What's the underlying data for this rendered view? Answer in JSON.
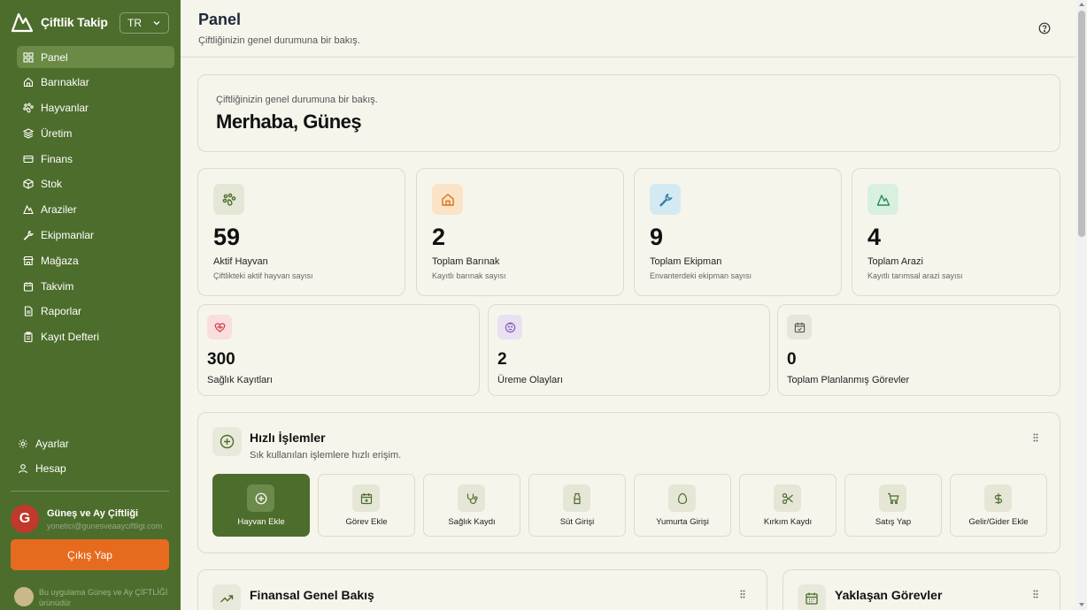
{
  "app": {
    "name": "Çiftlik Takip",
    "language": "TR"
  },
  "sidebar": {
    "items": [
      {
        "label": "Panel",
        "icon": "grid-icon",
        "active": true
      },
      {
        "label": "Barınaklar",
        "icon": "home-icon"
      },
      {
        "label": "Hayvanlar",
        "icon": "paw-icon"
      },
      {
        "label": "Üretim",
        "icon": "layers-icon"
      },
      {
        "label": "Finans",
        "icon": "card-icon"
      },
      {
        "label": "Stok",
        "icon": "box-icon"
      },
      {
        "label": "Araziler",
        "icon": "mountain-icon"
      },
      {
        "label": "Ekipmanlar",
        "icon": "wrench-icon"
      },
      {
        "label": "Mağaza",
        "icon": "store-icon"
      },
      {
        "label": "Takvim",
        "icon": "calendar-icon"
      },
      {
        "label": "Raporlar",
        "icon": "file-icon"
      },
      {
        "label": "Kayıt Defteri",
        "icon": "clipboard-icon"
      }
    ],
    "bottom": [
      {
        "label": "Ayarlar",
        "icon": "gear-icon"
      },
      {
        "label": "Hesap",
        "icon": "user-icon"
      }
    ],
    "user": {
      "initial": "G",
      "name": "Güneş ve Ay Çiftliği",
      "email": "yonetici@gunesveaayciftligi.com"
    },
    "logout_label": "Çıkış Yap",
    "footer_note": "Bu uygulama Güneş ve Ay ÇİFTLİĞİ ürünüdür"
  },
  "header": {
    "title": "Panel",
    "subtitle": "Çiftliğinizin genel durumuna bir bakış."
  },
  "welcome": {
    "subtitle": "Çiftliğinizin genel durumuna bir bakış.",
    "title": "Merhaba, Güneş"
  },
  "stats": [
    {
      "value": "59",
      "label": "Aktif Hayvan",
      "desc": "Çiftlikteki aktif hayvan sayısı",
      "icon": "paw-icon",
      "bg": "#e4e6d6",
      "fg": "#4d6d2c"
    },
    {
      "value": "2",
      "label": "Toplam Barınak",
      "desc": "Kayıtlı barınak sayısı",
      "icon": "home-icon",
      "bg": "#fbe3c8",
      "fg": "#d9731e"
    },
    {
      "value": "9",
      "label": "Toplam Ekipman",
      "desc": "Envanterdeki ekipman sayısı",
      "icon": "wrench-icon",
      "bg": "#d4eaf3",
      "fg": "#2f7fa8"
    },
    {
      "value": "4",
      "label": "Toplam Arazi",
      "desc": "Kayıtlı tarımsal arazi sayısı",
      "icon": "mountain-icon",
      "bg": "#d9f0e1",
      "fg": "#2e8a55"
    }
  ],
  "stats2": [
    {
      "value": "300",
      "label": "Sağlık Kayıtları",
      "icon": "heart-icon",
      "bg": "#f9dede",
      "fg": "#d33b4a"
    },
    {
      "value": "2",
      "label": "Üreme Olayları",
      "icon": "baby-icon",
      "bg": "#e9e0f2",
      "fg": "#8a57c0"
    },
    {
      "value": "0",
      "label": "Toplam Planlanmış Görevler",
      "icon": "calendar-icon",
      "bg": "#e6e6db",
      "fg": "#555"
    }
  ],
  "quick": {
    "title": "Hızlı İşlemler",
    "subtitle": "Sık kullanılan işlemlere hızlı erişim.",
    "actions": [
      {
        "label": "Hayvan Ekle",
        "icon": "plus-circle-icon"
      },
      {
        "label": "Görev Ekle",
        "icon": "calendar-plus-icon"
      },
      {
        "label": "Sağlık Kaydı",
        "icon": "stethoscope-icon"
      },
      {
        "label": "Süt Girişi",
        "icon": "milk-icon"
      },
      {
        "label": "Yumurta Girişi",
        "icon": "egg-icon"
      },
      {
        "label": "Kırkım Kaydı",
        "icon": "scissors-icon"
      },
      {
        "label": "Satış Yap",
        "icon": "cart-icon"
      },
      {
        "label": "Gelir/Gider Ekle",
        "icon": "dollar-icon"
      }
    ]
  },
  "finance": {
    "title": "Finansal Genel Bakış"
  },
  "tasks": {
    "title": "Yaklaşan Görevler"
  }
}
